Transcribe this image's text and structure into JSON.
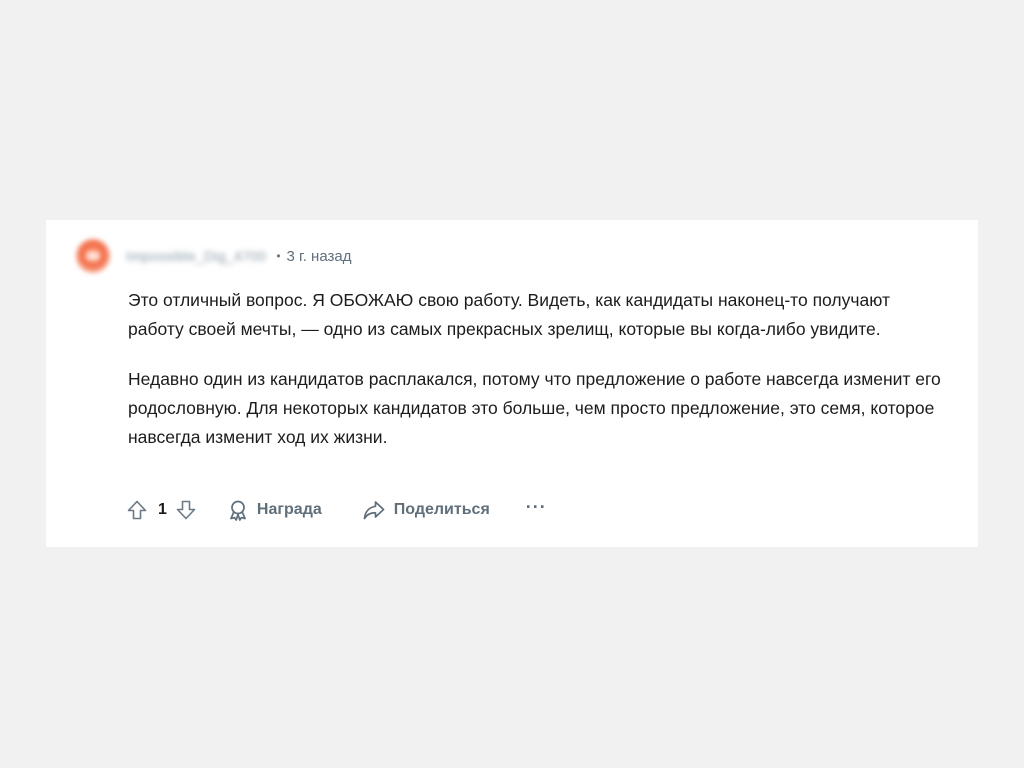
{
  "comment": {
    "author": "Impossible_Dig_4700",
    "separator": "•",
    "time_ago": "3 г. назад",
    "paragraphs": [
      "Это отличный вопрос. Я ОБОЖАЮ свою работу. Видеть, как кандидаты наконец-то получают работу своей мечты, — одно из самых прекрасных зрелищ, которые вы когда-либо увидите.",
      "Недавно один из кандидатов расплакался, потому что предложение о работе навсегда изменит его родословную. Для некоторых кандидатов это больше, чем просто предложение, это семя, которое навсегда изменит ход их жизни."
    ]
  },
  "actions": {
    "vote_count": "1",
    "award_label": "Награда",
    "share_label": "Поделиться",
    "more_label": "···"
  },
  "icons": {
    "upvote": "upvote-arrow-icon",
    "downvote": "downvote-arrow-icon",
    "award": "award-ribbon-icon",
    "share": "share-arrow-icon"
  },
  "colors": {
    "page_background": "#f1f1f1",
    "card_background": "#ffffff",
    "text_primary": "#1c1c1c",
    "text_secondary": "#5f6f7b",
    "avatar_accent": "#f36c48"
  }
}
